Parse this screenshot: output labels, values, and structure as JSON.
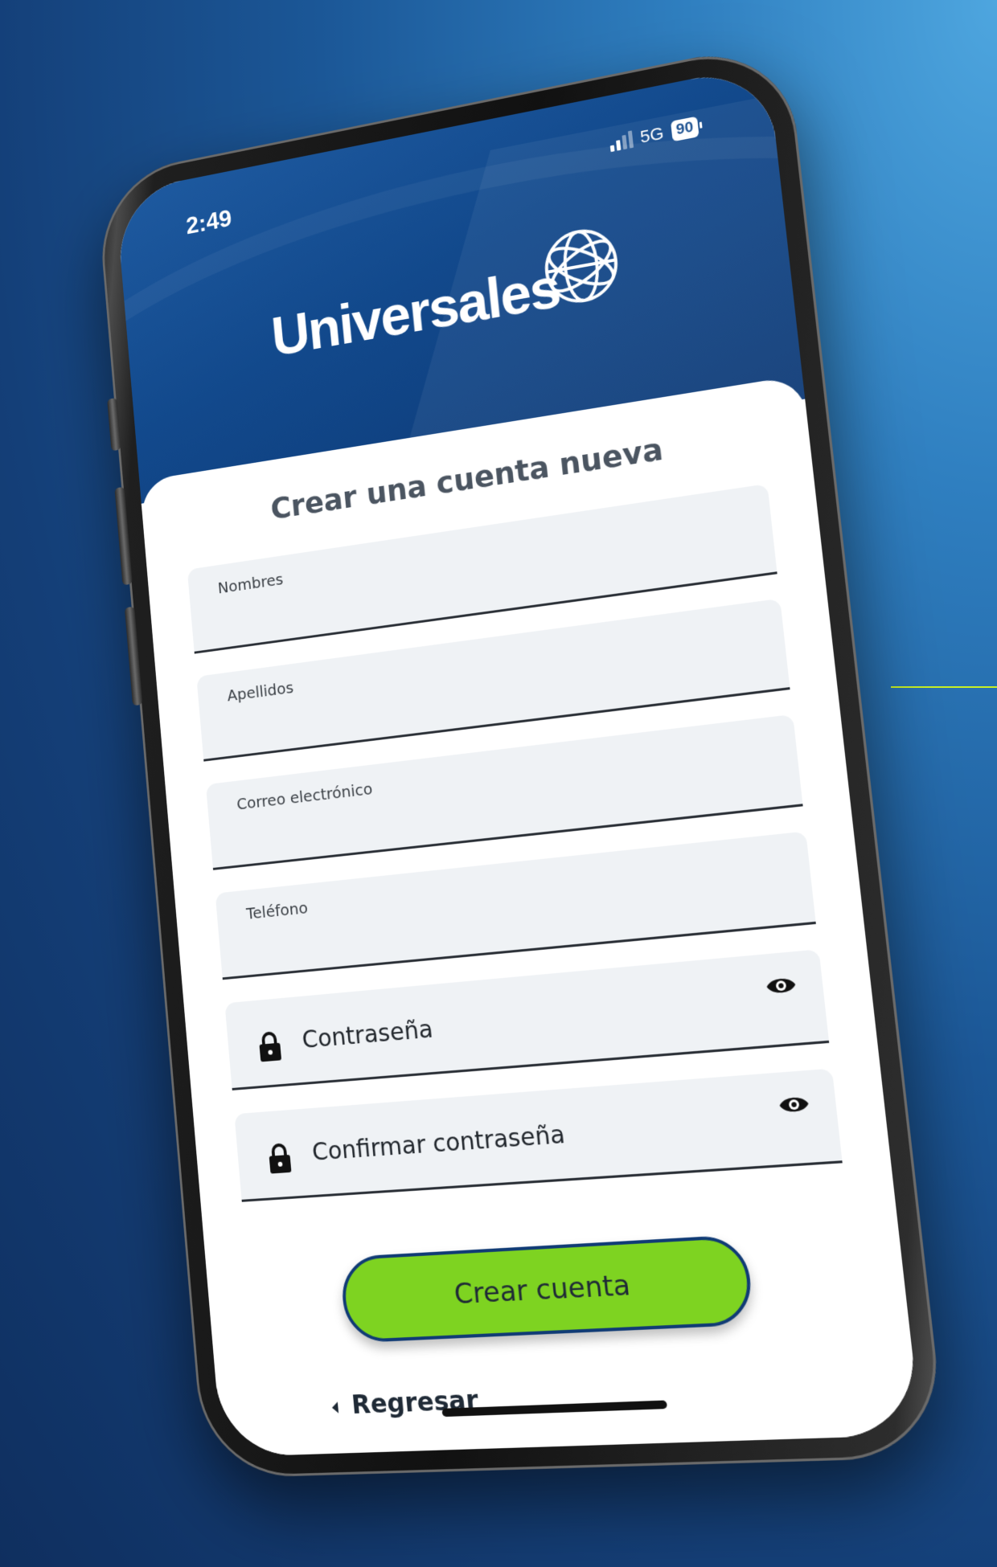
{
  "status_bar": {
    "time": "2:49",
    "network": "5G",
    "battery": "90"
  },
  "brand": {
    "name": "Universales"
  },
  "form": {
    "title": "Crear una cuenta nueva",
    "fields": [
      {
        "label": "Nombres"
      },
      {
        "label": "Apellidos"
      },
      {
        "label": "Correo electrónico"
      },
      {
        "label": "Teléfono"
      }
    ],
    "password": {
      "placeholder": "Contraseña"
    },
    "confirm_password": {
      "placeholder": "Confirmar contraseña"
    },
    "submit_label": "Crear cuenta",
    "back_label": "Regresar"
  },
  "colors": {
    "header_blue": "#12498c",
    "button_green": "#7ed321",
    "button_border": "#103b75",
    "accent_line": "#c8f025",
    "field_bg": "#eff2f5"
  },
  "icons": [
    "lock-icon",
    "eye-icon",
    "chevron-left-icon",
    "globe-logo-icon",
    "signal-icon",
    "battery-icon"
  ]
}
